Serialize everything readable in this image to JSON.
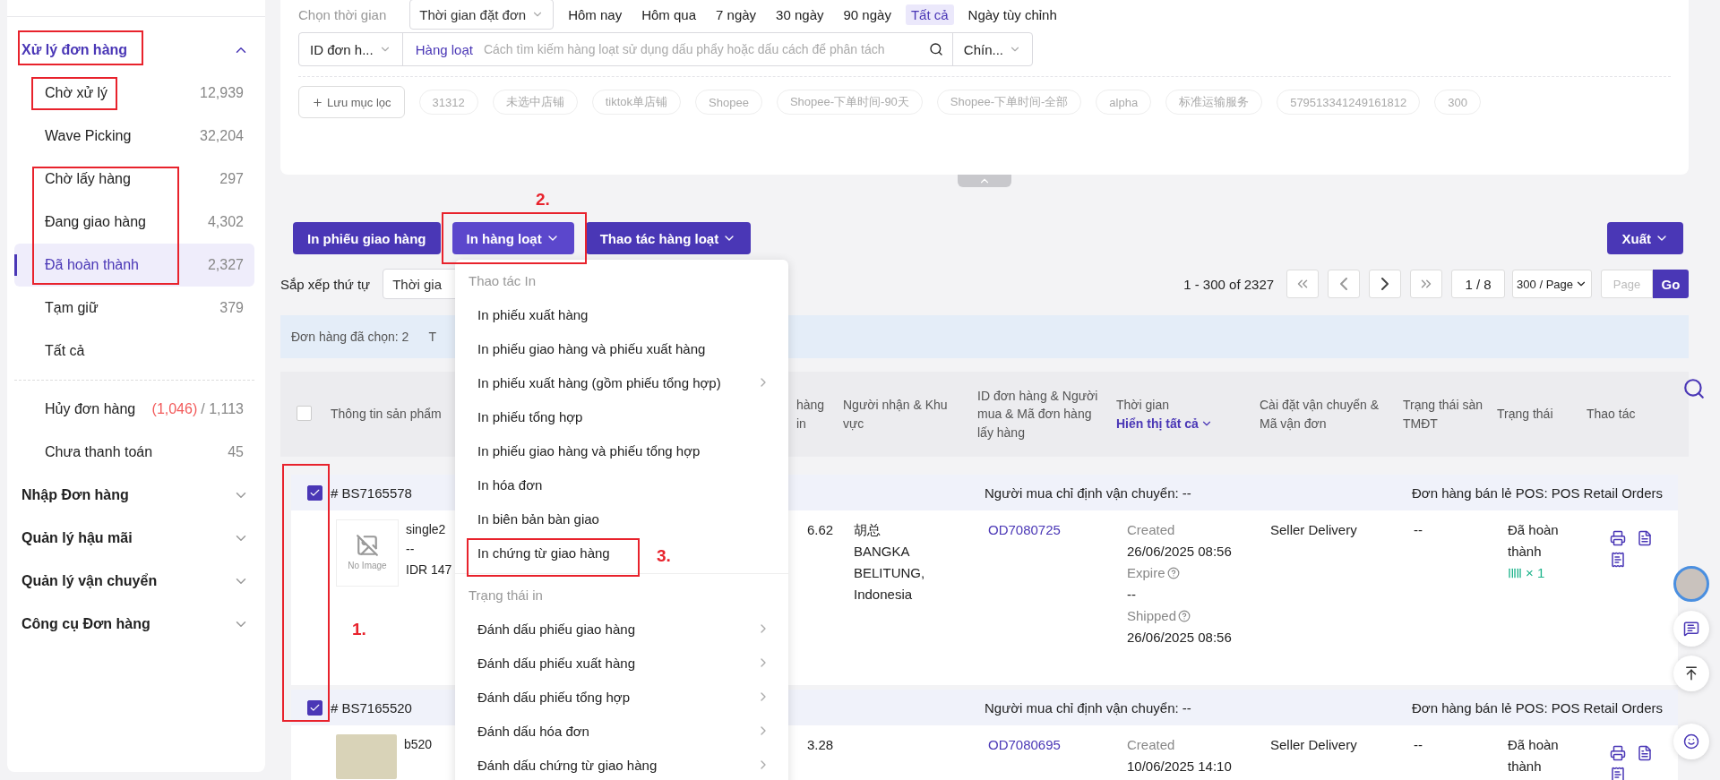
{
  "sidebar": {
    "groups": [
      {
        "label": "Xử lý đơn hàng",
        "expanded": true,
        "items": [
          {
            "label": "Chờ xử lý",
            "count": "12,939",
            "selected": false
          },
          {
            "label": "Wave Picking",
            "count": "32,204",
            "selected": false
          },
          {
            "label": "Chờ lấy hàng",
            "count": "297",
            "selected": false
          },
          {
            "label": "Đang giao hàng",
            "count": "4,302",
            "selected": false
          },
          {
            "label": "Đã hoàn thành",
            "count": "2,327",
            "selected": true
          },
          {
            "label": "Tạm giữ",
            "count": "379",
            "selected": false
          },
          {
            "label": "Tất cả",
            "selected": false
          }
        ],
        "extra_items": [
          {
            "label": "Hủy đơn hàng",
            "alert_count": "(1,046)",
            "count": "/ 1,113",
            "selected": false
          },
          {
            "label": "Chưa thanh toán",
            "count": "45",
            "selected": false
          }
        ]
      },
      {
        "label": "Nhập Đơn hàng",
        "expanded": false
      },
      {
        "label": "Quản lý hậu mãi",
        "expanded": false
      },
      {
        "label": "Quản lý vận chuyển",
        "expanded": false
      },
      {
        "label": "Công cụ Đơn hàng",
        "expanded": false
      }
    ]
  },
  "filters": {
    "time_label": "Chọn thời gian",
    "time_type": "Thời gian đặt đơn",
    "time_options": [
      {
        "label": "Hôm nay",
        "selected": false
      },
      {
        "label": "Hôm qua",
        "selected": false
      },
      {
        "label": "7 ngày",
        "selected": false
      },
      {
        "label": "30 ngày",
        "selected": false
      },
      {
        "label": "90 ngày",
        "selected": false
      },
      {
        "label": "Tất cả",
        "selected": true
      },
      {
        "label": "Ngày tùy chỉnh",
        "selected": false
      }
    ],
    "search": {
      "field": "ID đơn h...",
      "mode": "Hàng loạt",
      "placeholder": "Cách tìm kiếm hàng loạt sử dụng dấu phẩy hoặc dấu cách để phân tách",
      "scope": "Chín..."
    },
    "save_filter": "Lưu mục lọc",
    "saved_filters": [
      "31312",
      "未选中店铺",
      "tiktok单店铺",
      "Shopee",
      "Shopee-下单时间-90天",
      "Shopee-下单时间-全部",
      "alpha",
      "标准运输服务",
      "579513341249161812",
      "300"
    ]
  },
  "toolbar": {
    "actions": [
      {
        "label": "In phiếu giao hàng",
        "dropdown": false,
        "active": false
      },
      {
        "label": "In hàng loạt",
        "dropdown": true,
        "active": true
      },
      {
        "label": "Thao tác hàng loạt",
        "dropdown": true,
        "active": false
      }
    ],
    "export": {
      "label": "Xuất",
      "dropdown": true
    }
  },
  "sort": {
    "label": "Sắp xếp thứ tự",
    "value": "Thời gia"
  },
  "pagination": {
    "range": "1 - 300 of 2327",
    "page": "1 / 8",
    "page_size": "300 / Page",
    "goto_placeholder": "Page",
    "go": "Go"
  },
  "selection_bar": {
    "text": "Đơn hàng đã chọn: 2",
    "column_2": "T"
  },
  "table": {
    "columns": [
      {
        "label": "Thông tin sản phẩm"
      },
      {
        "label": "hàng in"
      },
      {
        "label": "Người nhận & Khu vực"
      },
      {
        "label": "ID đơn hàng & Người mua & Mã đơn hàng lấy hàng"
      },
      {
        "label": "Thời gian",
        "link": "Hiển thị tất cả"
      },
      {
        "label": "Cài đặt vận chuyển & Mã vận đơn"
      },
      {
        "label": "Trạng thái sàn TMĐT"
      },
      {
        "label": "Trạng thái"
      },
      {
        "label": "Thao tác"
      }
    ],
    "all_checked": false,
    "orders": [
      {
        "id": "# BS7165578",
        "checked": true,
        "shipping_note": "Người mua chỉ định vận chuyển: --",
        "order_type": "Đơn hàng bán lẻ POS: POS Retail Orders",
        "product": {
          "kind": "placeholder",
          "image_text": "No Image",
          "name": "single2",
          "variant": "--",
          "price": "IDR 147"
        },
        "amount": "6.62",
        "recipient": "胡总",
        "address": "BANGKA BELITUNG, Indonesia",
        "order_no": "OD7080725",
        "times": [
          {
            "label": "Created",
            "help": false,
            "value": "26/06/2025 08:56"
          },
          {
            "label": "Expire",
            "help": true,
            "value": "--"
          },
          {
            "label": "Shipped",
            "help": true,
            "value": "26/06/2025 08:56"
          }
        ],
        "shipping": "Seller Delivery",
        "platform_status": "--",
        "status": "Đã hoàn thành",
        "barcode_count": "× 1"
      },
      {
        "id": "# BS7165520",
        "checked": true,
        "shipping_note": "Người mua chỉ định vận chuyển: --",
        "order_type": "Đơn hàng bán lẻ POS: POS Retail Orders",
        "product": {
          "kind": "photo",
          "name": "b520"
        },
        "amount": "3.28",
        "order_no": "OD7080695",
        "times": [
          {
            "label": "Created",
            "help": false,
            "value": "10/06/2025 14:10"
          }
        ],
        "shipping": "Seller Delivery",
        "platform_status": "--",
        "status": "Đã hoàn thành"
      }
    ]
  },
  "print_menu": {
    "sections": [
      {
        "title": "Thao tác In",
        "items": [
          {
            "label": "In phiếu xuất hàng",
            "submenu": false
          },
          {
            "label": "In phiếu giao hàng và phiếu xuất hàng",
            "submenu": false
          },
          {
            "label": "In phiếu xuất hàng (gồm phiếu tổng hợp)",
            "submenu": true
          },
          {
            "label": "In phiếu tổng hợp",
            "submenu": false
          },
          {
            "label": "In phiếu giao hàng và phiếu tổng hợp",
            "submenu": false
          },
          {
            "label": "In hóa đơn",
            "submenu": false
          },
          {
            "label": "In biên bản bàn giao",
            "submenu": false
          },
          {
            "label": "In chứng từ giao hàng",
            "submenu": false
          }
        ]
      },
      {
        "title": "Trạng thái in",
        "items": [
          {
            "label": "Đánh dấu phiếu giao hàng",
            "submenu": true
          },
          {
            "label": "Đánh dấu phiếu xuất hàng",
            "submenu": true
          },
          {
            "label": "Đánh dấu phiếu tổng hợp",
            "submenu": true
          },
          {
            "label": "Đánh dấu hóa đơn",
            "submenu": true
          },
          {
            "label": "Đánh dấu chứng từ giao hàng",
            "submenu": true
          }
        ]
      }
    ]
  },
  "annotations": [
    "1.",
    "2.",
    "3."
  ]
}
